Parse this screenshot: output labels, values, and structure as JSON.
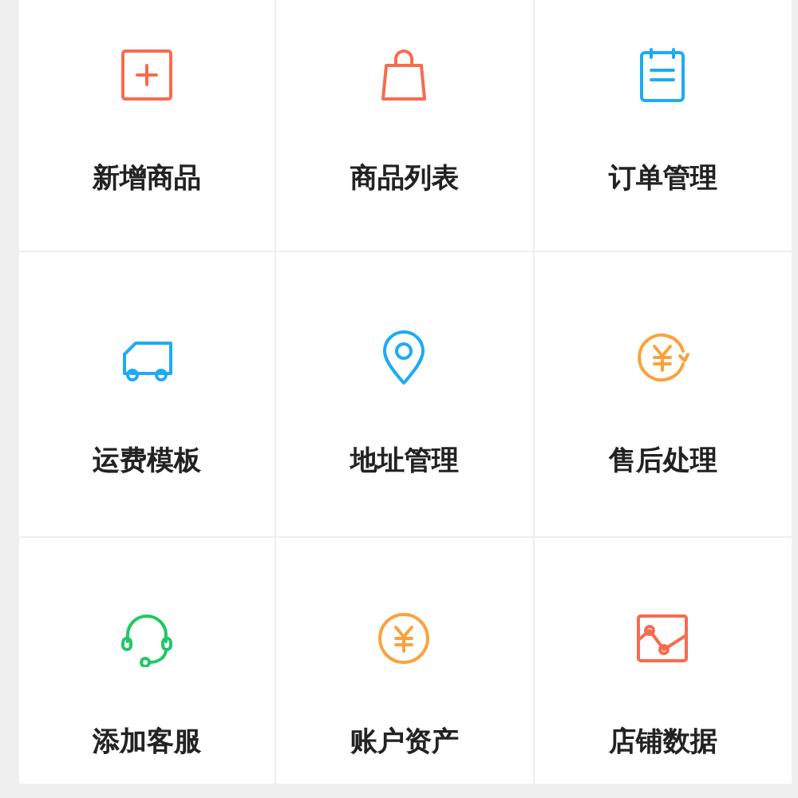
{
  "items": [
    {
      "label": "新增商品",
      "color": "#fa6a4e"
    },
    {
      "label": "商品列表",
      "color": "#fa6a4e"
    },
    {
      "label": "订单管理",
      "color": "#1eaaf5"
    },
    {
      "label": "运费模板",
      "color": "#1eaaf5"
    },
    {
      "label": "地址管理",
      "color": "#1eaaf5"
    },
    {
      "label": "售后处理",
      "color": "#fba23c"
    },
    {
      "label": "添加客服",
      "color": "#1fc865"
    },
    {
      "label": "账户资产",
      "color": "#fba23c"
    },
    {
      "label": "店铺数据",
      "color": "#fa6a4e"
    }
  ]
}
